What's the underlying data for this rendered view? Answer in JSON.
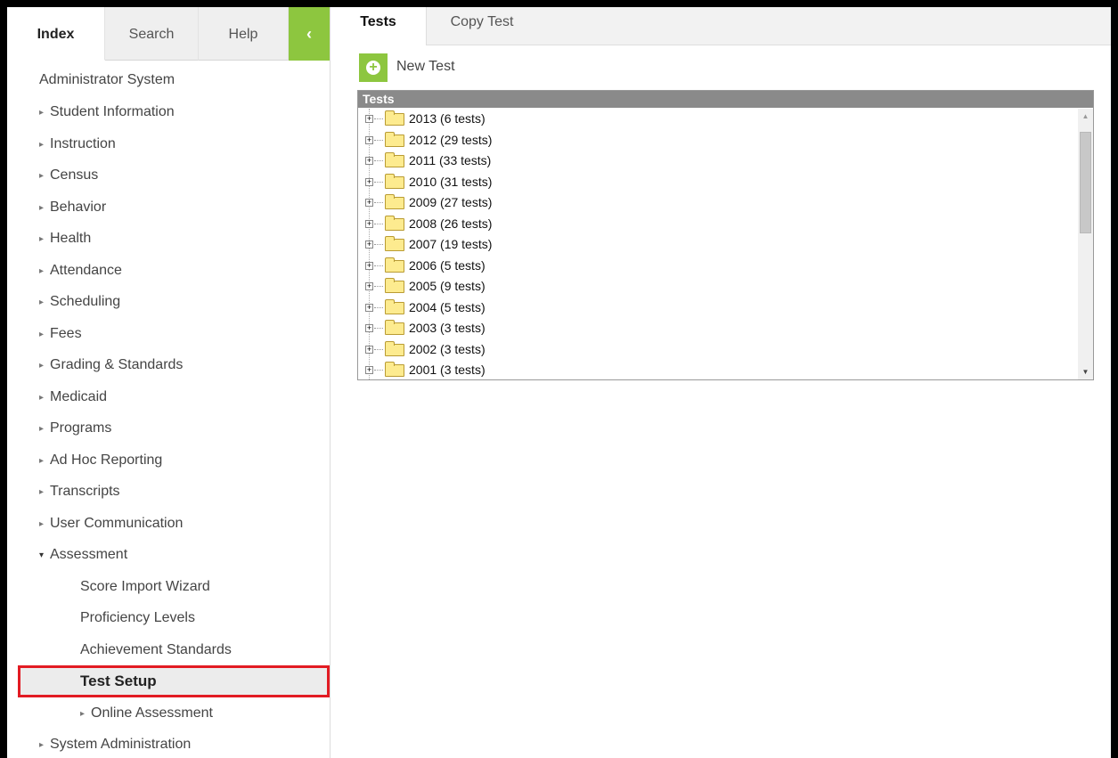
{
  "sidebar": {
    "tabs": [
      {
        "label": "Index"
      },
      {
        "label": "Search"
      },
      {
        "label": "Help"
      }
    ],
    "collapse_glyph": "‹",
    "title": "Administrator System",
    "items": [
      {
        "label": "Student Information"
      },
      {
        "label": "Instruction"
      },
      {
        "label": "Census"
      },
      {
        "label": "Behavior"
      },
      {
        "label": "Health"
      },
      {
        "label": "Attendance"
      },
      {
        "label": "Scheduling"
      },
      {
        "label": "Fees"
      },
      {
        "label": "Grading & Standards"
      },
      {
        "label": "Medicaid"
      },
      {
        "label": "Programs"
      },
      {
        "label": "Ad Hoc Reporting"
      },
      {
        "label": "Transcripts"
      },
      {
        "label": "User Communication"
      },
      {
        "label": "Assessment"
      },
      {
        "label": "Score Import Wizard"
      },
      {
        "label": "Proficiency Levels"
      },
      {
        "label": "Achievement Standards"
      },
      {
        "label": "Test Setup"
      },
      {
        "label": "Online Assessment"
      },
      {
        "label": "System Administration"
      }
    ]
  },
  "main": {
    "tabs": [
      {
        "label": "Tests"
      },
      {
        "label": "Copy Test"
      }
    ],
    "new_test_label": "New Test",
    "panel_title": "Tests",
    "tree_items": [
      {
        "label": "2013 (6 tests)"
      },
      {
        "label": "2012 (29 tests)"
      },
      {
        "label": "2011 (33 tests)"
      },
      {
        "label": "2010 (31 tests)"
      },
      {
        "label": "2009 (27 tests)"
      },
      {
        "label": "2008 (26 tests)"
      },
      {
        "label": "2007 (19 tests)"
      },
      {
        "label": "2006 (5 tests)"
      },
      {
        "label": "2005 (9 tests)"
      },
      {
        "label": "2004 (5 tests)"
      },
      {
        "label": "2003 (3 tests)"
      },
      {
        "label": "2002 (3 tests)"
      },
      {
        "label": "2001 (3 tests)"
      }
    ]
  },
  "colors": {
    "accent_green": "#8dc63f",
    "highlight_red": "#e21b23",
    "panel_header": "#8a8a8a"
  }
}
